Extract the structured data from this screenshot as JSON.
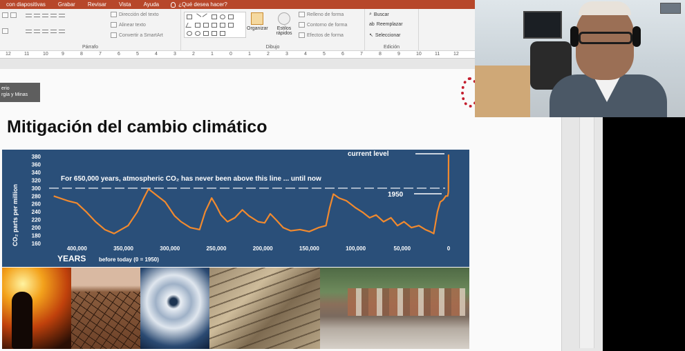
{
  "ribbon": {
    "tabs": [
      "con diapositivas",
      "Grabar",
      "Revisar",
      "Vista",
      "Ayuda"
    ],
    "tell_me": "¿Qué desea hacer?",
    "paragraph": {
      "label": "Párrafo",
      "text_direction": "Dirección del texto",
      "align_text": "Alinear texto",
      "convert_smartart": "Convertir a SmartArt"
    },
    "drawing": {
      "label": "Dibujo",
      "arrange": "Organizar",
      "quick_styles": "Estilos rápidos",
      "shape_fill": "Relleno de forma",
      "shape_outline": "Contorno de forma",
      "shape_effects": "Efectos de forma"
    },
    "editing": {
      "label": "Edición",
      "find": "Buscar",
      "replace": "Reemplazar",
      "select": "Seleccionar"
    }
  },
  "ruler": {
    "ticks": [
      "12",
      "11",
      "10",
      "9",
      "8",
      "7",
      "6",
      "5",
      "4",
      "3",
      "2",
      "1",
      "0",
      "1",
      "2",
      "3",
      "4",
      "5",
      "6",
      "7",
      "8",
      "9",
      "10",
      "11",
      "12"
    ]
  },
  "slide": {
    "logo_lines": [
      "erio",
      "rgía y Minas"
    ],
    "title": "Mitigación del cambio climático"
  },
  "chart_data": {
    "type": "line",
    "title": "",
    "banner": "For 650,000 years, atmospheric CO₂ has never been above this line ... until now",
    "ylabel": "CO₂ parts per million",
    "xlabel": "YEARS",
    "xlabel_note": "before today (0 = 1950)",
    "annotation_current": "current level",
    "annotation_1950": "1950",
    "ylim": [
      160,
      380
    ],
    "xlim": [
      430000,
      0
    ],
    "yticks": [
      380,
      360,
      340,
      320,
      300,
      280,
      260,
      240,
      220,
      200,
      180,
      160
    ],
    "xticks": [
      {
        "value": 400000,
        "label": "400,000"
      },
      {
        "value": 350000,
        "label": "350,000"
      },
      {
        "value": 300000,
        "label": "300,000"
      },
      {
        "value": 250000,
        "label": "250,000"
      },
      {
        "value": 200000,
        "label": "200,000"
      },
      {
        "value": 150000,
        "label": "150,000"
      },
      {
        "value": 100000,
        "label": "100,000"
      },
      {
        "value": 50000,
        "label": "50,000"
      },
      {
        "value": 0,
        "label": "0"
      }
    ],
    "threshold": 300,
    "series": [
      {
        "x": [
          425000,
          410000,
          400000,
          390000,
          380000,
          370000,
          360000,
          345000,
          335000,
          328000,
          323000,
          316000,
          305000,
          295000,
          288000,
          278000,
          268000,
          262000,
          255000,
          250000,
          245000,
          238000,
          230000,
          222000,
          215000,
          205000,
          198000,
          192000,
          185000,
          178000,
          170000,
          160000,
          150000,
          140000,
          132000,
          128000,
          124000,
          118000,
          110000,
          100000,
          92000,
          85000,
          78000,
          70000,
          62000,
          55000,
          48000,
          40000,
          32000,
          25000,
          20000,
          16000,
          12000,
          9000,
          6000,
          3000,
          1000,
          200
        ],
        "y": [
          280,
          268,
          262,
          240,
          215,
          195,
          185,
          205,
          240,
          275,
          298,
          285,
          265,
          230,
          215,
          200,
          195,
          240,
          275,
          255,
          232,
          215,
          225,
          245,
          230,
          215,
          212,
          235,
          218,
          200,
          192,
          195,
          190,
          200,
          205,
          250,
          285,
          275,
          268,
          250,
          238,
          225,
          232,
          215,
          225,
          205,
          215,
          200,
          205,
          195,
          190,
          185,
          240,
          265,
          270,
          280,
          280,
          290
        ]
      }
    ],
    "current_value": 385
  }
}
